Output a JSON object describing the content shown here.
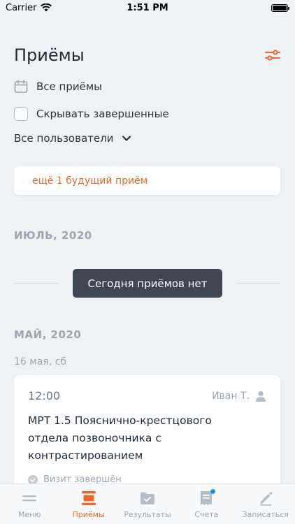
{
  "status_bar": {
    "carrier": "Carrier",
    "time": "1:51 PM"
  },
  "header": {
    "title": "Приёмы"
  },
  "filters": {
    "all_appointments": "Все приёмы",
    "hide_completed": "Скрывать завершенные",
    "users_dropdown": "Все пользователи"
  },
  "future_notice": "ещё 1 будущий приём",
  "sections": {
    "july": {
      "month": "ИЮЛЬ, 2020",
      "empty_message": "Сегодня приёмов нет"
    },
    "may": {
      "month": "МАЙ, 2020",
      "day": "16 мая, сб",
      "appointment": {
        "time": "12:00",
        "patient": "Иван Т.",
        "title": "МРТ 1.5 Пояснично-крестцового отдела позвоночника с контрастированием",
        "status": "Визит завершён"
      }
    }
  },
  "tabs": [
    {
      "label": "Меню",
      "icon": "menu-icon"
    },
    {
      "label": "Приёмы",
      "icon": "appointments-icon"
    },
    {
      "label": "Результаты",
      "icon": "results-folder-icon"
    },
    {
      "label": "Счета",
      "icon": "receipt-icon"
    },
    {
      "label": "Записаться",
      "icon": "pencil-icon"
    }
  ],
  "colors": {
    "accent": "#e8682e",
    "muted": "#9aa6b2",
    "badge": "#2a8fe8"
  }
}
